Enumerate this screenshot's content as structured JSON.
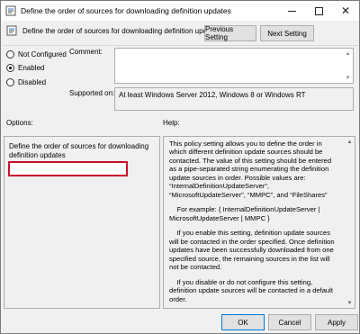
{
  "window": {
    "title": "Define the order of sources for downloading definition updates",
    "close_glyph": "✕"
  },
  "header": {
    "setting_name": "Define the order of sources for downloading definition updates",
    "prev_label": "Previous Setting",
    "next_label": "Next Setting"
  },
  "state": {
    "not_configured_label": "Not Configured",
    "enabled_label": "Enabled",
    "disabled_label": "Disabled",
    "selected": "Enabled"
  },
  "comment": {
    "label": "Comment:",
    "value": ""
  },
  "supported": {
    "label": "Supported on:",
    "value": "At least Windows Server 2012, Windows 8 or Windows RT"
  },
  "options": {
    "label": "Options:",
    "field_label": "Define the order of sources for downloading definition updates",
    "field_value": ""
  },
  "help": {
    "label": "Help:",
    "paragraphs": [
      "This policy setting allows you to define the order in which different definition update sources should be contacted. The value of this setting should be entered as a pipe-separated string enumerating the definition update sources in order. Possible values are: “InternalDefinitionUpdateServer”, “MicrosoftUpdateServer”, “MMPC”, and “FileShares”",
      "    For example: { InternalDefinitionUpdateServer | MicrosoftUpdateServer | MMPC }",
      "    If you enable this setting, definition update sources will be contacted in the order specified. Once definition updates have been successfully downloaded from one specified source, the remaining sources in the list will not be contacted.",
      "    If you disable or do not configure this setting, definition update sources will be contacted in a default order."
    ]
  },
  "footer": {
    "ok_label": "OK",
    "cancel_label": "Cancel",
    "apply_label": "Apply"
  },
  "colors": {
    "highlight": "#c8102e",
    "accent": "#0078d7"
  }
}
